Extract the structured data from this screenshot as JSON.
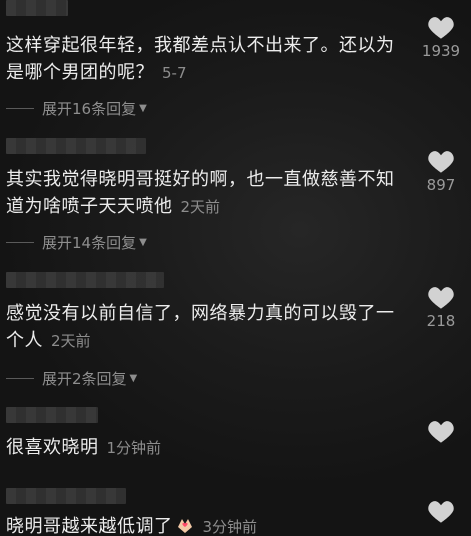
{
  "comments": [
    {
      "text": "这样穿起很年轻，我都差点认不出来了。还以为是哪个男团的呢？",
      "time": "5-7",
      "likes": "1939",
      "replies": "展开16条回复"
    },
    {
      "text": "其实我觉得晓明哥挺好的啊，也一直做慈善不知道为啥喷子天天喷他",
      "time": "2天前",
      "likes": "897",
      "replies": "展开14条回复"
    },
    {
      "text": "感觉没有以前自信了，网络暴力真的可以毁了一个人",
      "time": "2天前",
      "likes": "218",
      "replies": "展开2条回复"
    },
    {
      "text": "很喜欢晓明",
      "time": "1分钟前",
      "likes": "",
      "replies": ""
    },
    {
      "text": "晓明哥越来越低调了",
      "time": "3分钟前",
      "likes": "",
      "replies": "",
      "emoji": "heart-hands-emoji"
    }
  ],
  "icons": {
    "like": "heart-icon",
    "expand": "caret-down-icon"
  },
  "colors": {
    "text": "#ececec",
    "meta": "#8d8d8d",
    "like_icon": "#d2d2d2"
  }
}
